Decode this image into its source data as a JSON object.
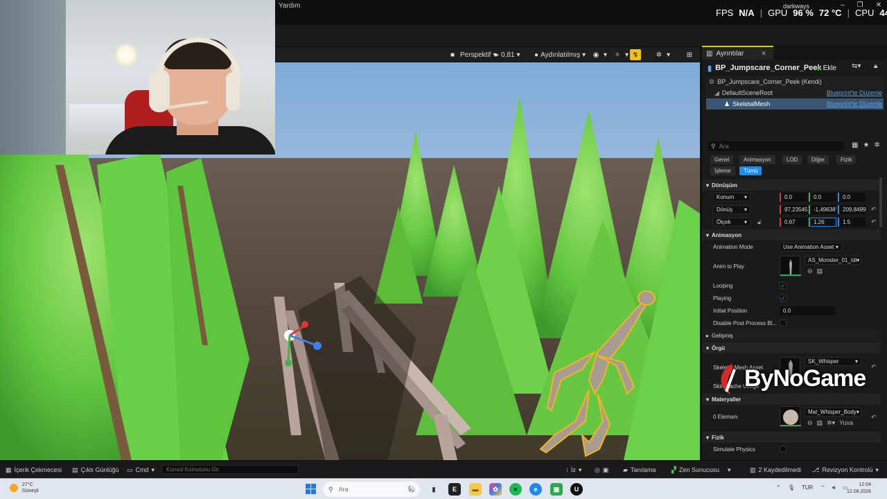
{
  "colors": {
    "accent": "#1f8be7",
    "link": "#5aa1e6",
    "selected": "#3a5672",
    "tab_highlight": "#d4c54a"
  },
  "menu": {
    "help": "Yardım"
  },
  "overlay": {
    "user": "darkways",
    "fps_label": "FPS",
    "fps_value": "N/A",
    "gpu_label": "GPU",
    "gpu_usage": "96 %",
    "gpu_temp": "72 °C",
    "cpu_label": "CPU",
    "cpu_usage": "44 %"
  },
  "viewport_toolbar": {
    "perspective": "Perspektif",
    "speed": "0,81",
    "lighting": "Aydınlatılmış"
  },
  "details": {
    "tab_label": "Ayrıntılar",
    "blueprint_name": "BP_Jumpscare_Corner_Peek",
    "add_label": "Ekle",
    "tree": [
      {
        "label": "BP_Jumpscare_Corner_Peek (Kendi)",
        "link": ""
      },
      {
        "label": "DefaultSceneRoot",
        "link": "Blueprint'te Düzenle"
      },
      {
        "label": "SkeletalMesh",
        "link": "Blueprint'te Düzenle"
      }
    ],
    "search_placeholder": "Ara",
    "categories": [
      "Genel",
      "Animasyon",
      "LOD",
      "Diğer",
      "Fizik",
      "İşleme",
      "Tümü"
    ],
    "active_category": "Tümü",
    "transform": {
      "section": "Dönüşüm",
      "location_label": "Konum",
      "location": [
        "0.0",
        "0.0",
        "0.0"
      ],
      "rotation_label": "Dönüş",
      "rotation": [
        "97,23545",
        "-1,49638°",
        "209,8499"
      ],
      "scale_label": "Ölçek",
      "scale": [
        "0.67",
        "1.26",
        "1.5"
      ]
    },
    "animation": {
      "section": "Animasyon",
      "mode_label": "Animation Mode",
      "mode_value": "Use Animation Asset",
      "anim_label": "Anim to Play",
      "anim_value": "AS_Monster_01_Idl",
      "looping_label": "Looping",
      "looping": true,
      "playing_label": "Playing",
      "playing": true,
      "initial_label": "Initial Position",
      "initial_value": "0.0",
      "disable_label": "Disable Post Process Bl...",
      "advanced": "Gelişmiş"
    },
    "mesh": {
      "section": "Örgü",
      "skeletal_label": "Skeletal Mesh Asset",
      "skeletal_value": "SK_Whisper",
      "skin_label": "Skin Cache Usage"
    },
    "materials": {
      "section": "Materyaller",
      "count_label": "0 Elemanı",
      "material_value": "Mat_Whisper_Body",
      "reload": "Yuva"
    },
    "physics": {
      "section": "Fizik",
      "simulate_label": "Simulate Physics"
    }
  },
  "watermark": "ByNoGame",
  "bottom_bar": {
    "content_drawer": "İçerik Çekmecesi",
    "output_log": "Çıktı Günlüğü",
    "cmd": "Cmd",
    "console_placeholder": "Konsol Komutunu Gir",
    "trace": "İz",
    "derived": "Tanılama",
    "zen": "Zen Sunucusu",
    "saved": "2 Kaydedilmedi",
    "revision": "Revizyon Kontrolü"
  },
  "taskbar": {
    "temp": "27°C",
    "weather": "Güneşli",
    "search_placeholder": "Ara",
    "lang": "TUR",
    "time": "12:04",
    "date": "12.08.2026"
  }
}
